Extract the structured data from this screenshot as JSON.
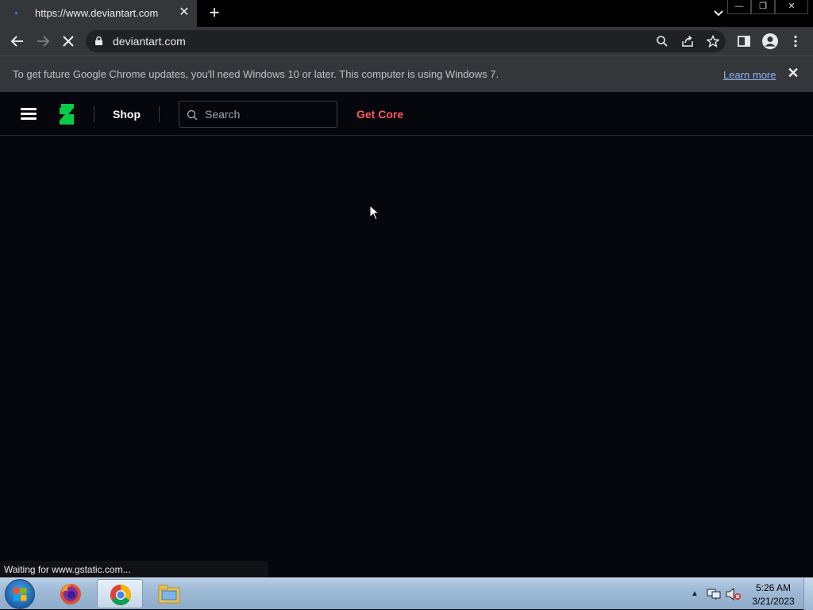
{
  "browser": {
    "tab_title": "https://www.deviantart.com",
    "new_tab_label": "+",
    "window_controls": {
      "minimize": "—",
      "restore": "❐",
      "close": "✕"
    },
    "url": "deviantart.com"
  },
  "infobar": {
    "message": "To get future Google Chrome updates, you'll need Windows 10 or later. This computer is using Windows 7.",
    "learn_more": "Learn more",
    "close": "✕"
  },
  "site": {
    "nav_shop": "Shop",
    "search_placeholder": "Search",
    "get_core": "Get Core",
    "accent_color": "#ff5a5f",
    "logo_color": "#05cc47"
  },
  "status": {
    "text": "Waiting for www.gstatic.com..."
  },
  "taskbar": {
    "apps": [
      "firefox-icon",
      "chrome-icon",
      "file-explorer-icon"
    ],
    "tray_arrow": "▲",
    "time": "5:26 AM",
    "date": "3/21/2023"
  }
}
